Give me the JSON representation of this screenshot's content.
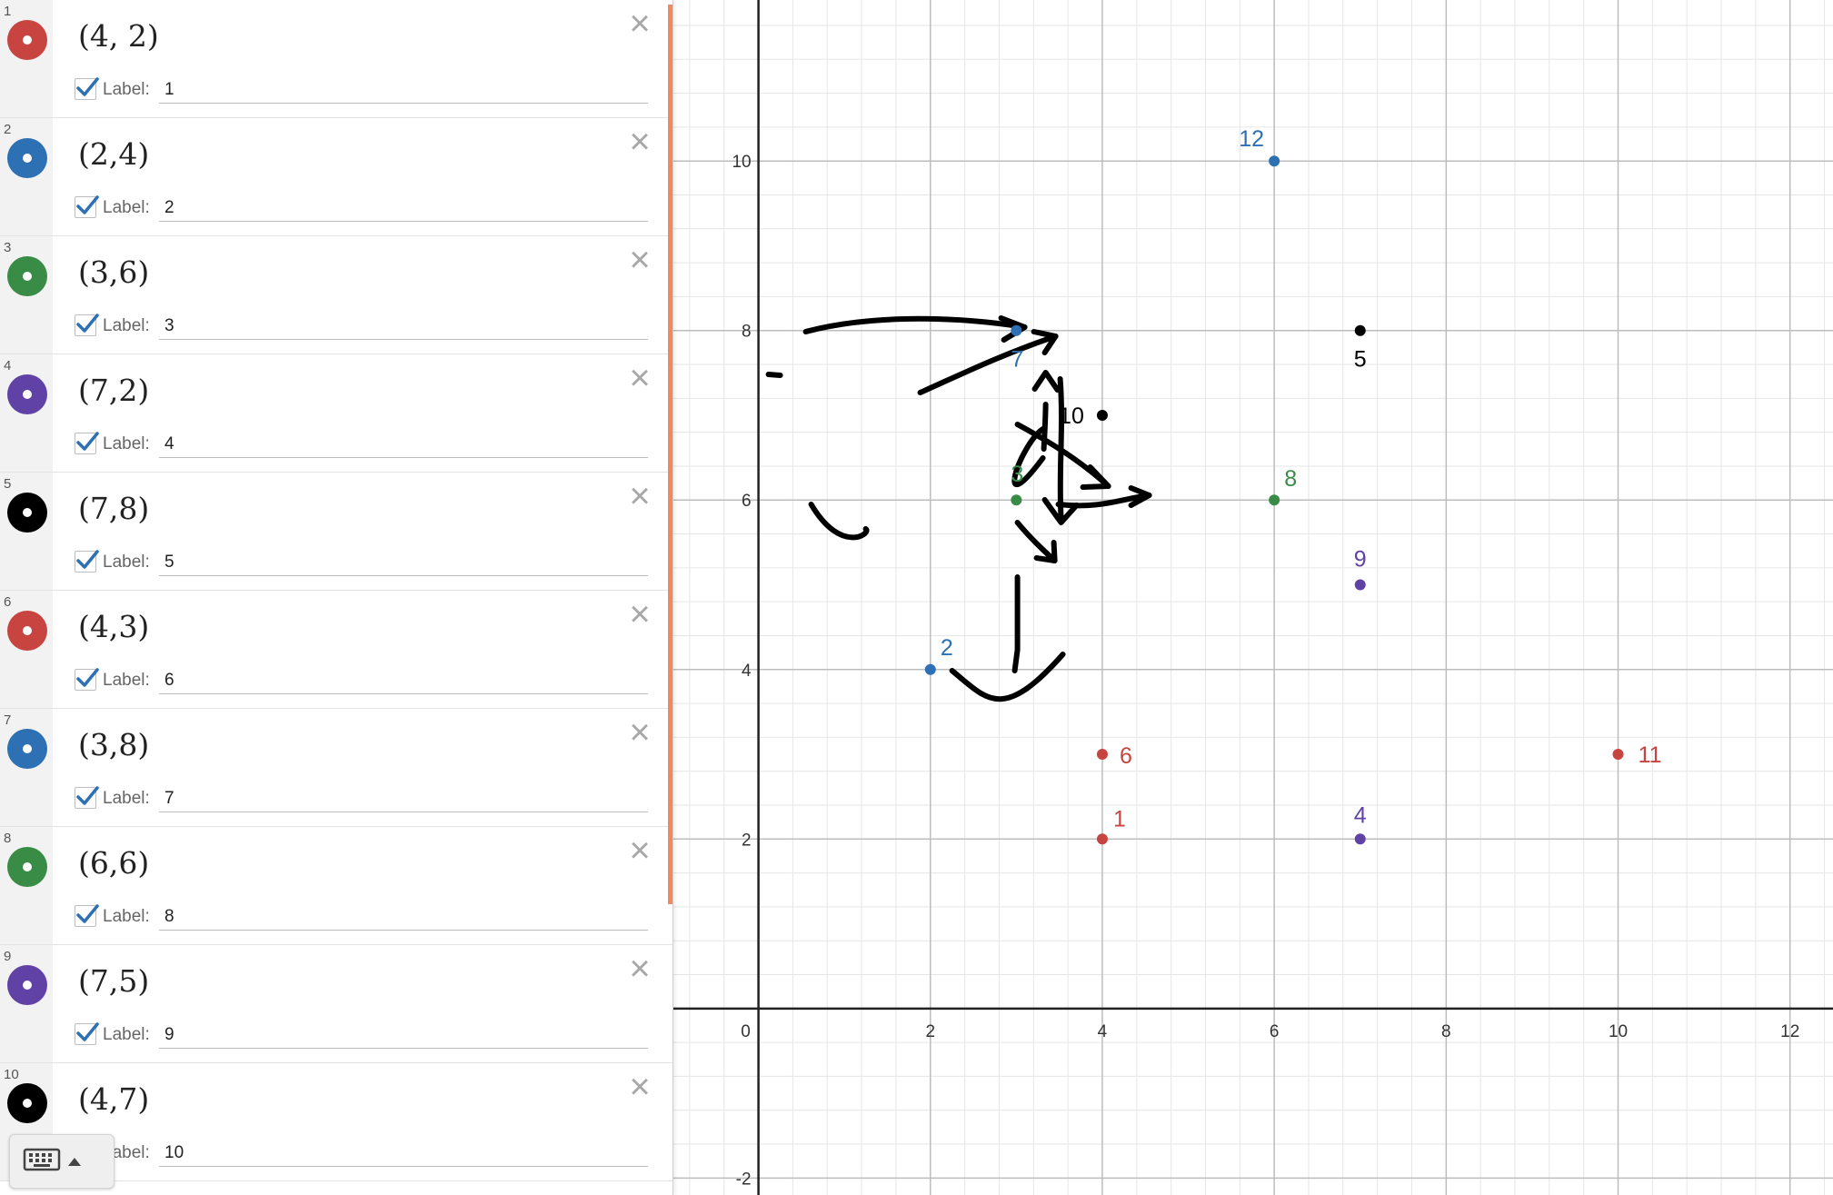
{
  "expressions": [
    {
      "index": "1",
      "latex": "(4, 2)",
      "x": 4,
      "y": 2,
      "color": "#c74440",
      "label_text": "Label:",
      "label_value": "1"
    },
    {
      "index": "2",
      "latex": "(2,4)",
      "x": 2,
      "y": 4,
      "color": "#2d70b3",
      "label_text": "Label:",
      "label_value": "2"
    },
    {
      "index": "3",
      "latex": "(3,6)",
      "x": 3,
      "y": 6,
      "color": "#388c46",
      "label_text": "Label:",
      "label_value": "3"
    },
    {
      "index": "4",
      "latex": "(7,2)",
      "x": 7,
      "y": 2,
      "color": "#6042a6",
      "label_text": "Label:",
      "label_value": "4"
    },
    {
      "index": "5",
      "latex": "(7,8)",
      "x": 7,
      "y": 8,
      "color": "#000000",
      "label_text": "Label:",
      "label_value": "5"
    },
    {
      "index": "6",
      "latex": "(4,3)",
      "x": 4,
      "y": 3,
      "color": "#c74440",
      "label_text": "Label:",
      "label_value": "6"
    },
    {
      "index": "7",
      "latex": "(3,8)",
      "x": 3,
      "y": 8,
      "color": "#2d70b3",
      "label_text": "Label:",
      "label_value": "7"
    },
    {
      "index": "8",
      "latex": "(6,6)",
      "x": 6,
      "y": 6,
      "color": "#388c46",
      "label_text": "Label:",
      "label_value": "8"
    },
    {
      "index": "9",
      "latex": "(7,5)",
      "x": 7,
      "y": 5,
      "color": "#6042a6",
      "label_text": "Label:",
      "label_value": "9"
    },
    {
      "index": "10",
      "latex": "(4,7)",
      "x": 4,
      "y": 7,
      "color": "#000000",
      "label_text": "Label:",
      "label_value": "10"
    }
  ],
  "extra_points": [
    {
      "x": 10,
      "y": 3,
      "color": "#c74440",
      "label_value": "11"
    },
    {
      "x": 6,
      "y": 10,
      "color": "#2d70b3",
      "label_value": "12"
    }
  ],
  "graph": {
    "x_ticks": [
      "0",
      "2",
      "4",
      "6",
      "8",
      "10",
      "12"
    ],
    "y_ticks": [
      "-2",
      "2",
      "4",
      "6",
      "8",
      "10"
    ],
    "x_range": [
      -1,
      12.5
    ],
    "y_range": [
      -2.2,
      11.9
    ]
  },
  "icons": {
    "close": "close-x-icon",
    "checkbox": "checkmark-icon",
    "keypad": "keyboard-icon",
    "expand": "caret-up-icon"
  }
}
